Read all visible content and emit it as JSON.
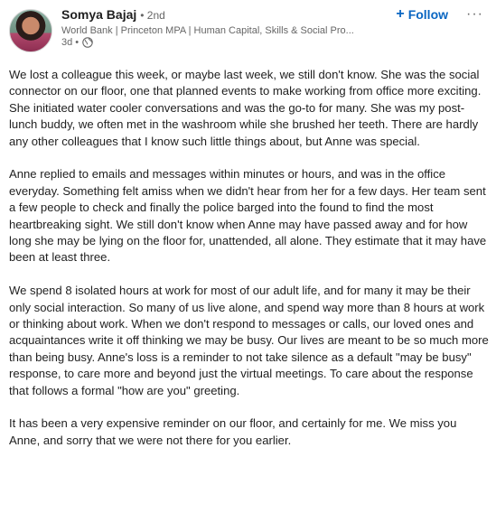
{
  "author": {
    "name": "Somya Bajaj",
    "degree": "• 2nd",
    "headline": "World Bank | Princeton MPA | Human Capital, Skills & Social Pro...",
    "time": "3d •"
  },
  "actions": {
    "follow_label": "Follow",
    "follow_icon": "plus-icon",
    "more_label": "···"
  },
  "icons": {
    "visibility": "globe-icon"
  },
  "colors": {
    "accent": "#0a66c2",
    "text": "#1f1f1f",
    "muted": "#666666"
  },
  "post": {
    "paragraphs": [
      "We lost a colleague this week, or maybe last week, we still don't know. She was the social connector on our floor, one that planned events to make working from office more exciting. She initiated water cooler conversations and was the go-to for many. She was my post-lunch buddy, we often met in the washroom while she brushed her teeth. There are hardly any other colleagues that I know such little things about, but Anne was special.",
      "Anne replied to emails and messages within minutes or hours, and was in the office everyday. Something felt amiss when we didn't hear from her for a few days. Her team sent a few people to check and finally the police barged into the found to find the most heartbreaking sight. We still don't know when Anne may have passed away and for how long she may be lying on the floor for, unattended, all alone. They estimate that it may have been at least three.",
      "We spend 8 isolated hours at work for most of our adult life, and for many it may be their only social interaction. So many of us live alone, and spend way more than 8 hours at work or thinking about work. When we don't respond to messages or calls, our loved ones and acquaintances write it off thinking we may be busy. Our lives are meant to be so much more than being busy. Anne's loss is a reminder to not take silence as a default \"may be busy\" response, to care more and beyond just the virtual meetings. To care about the response that follows a formal \"how are you\" greeting.",
      "It has been a very expensive reminder on our floor, and certainly for me. We miss you Anne, and sorry that we were not there for you earlier."
    ]
  }
}
